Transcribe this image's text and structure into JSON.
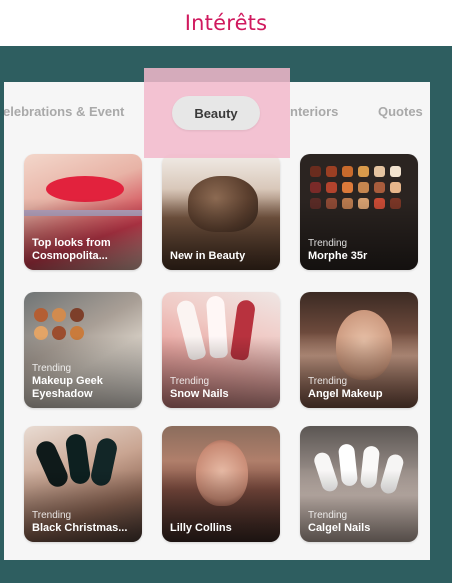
{
  "header": {
    "title": "Intérêts"
  },
  "tabs": [
    {
      "label": "elebrations & Event"
    },
    {
      "label": "Beauty"
    },
    {
      "label": "nteriors"
    },
    {
      "label": "Quotes"
    }
  ],
  "cards": [
    {
      "subtitle": "",
      "title": "Top looks from Cosmopolita..."
    },
    {
      "subtitle": "",
      "title": "New in Beauty"
    },
    {
      "subtitle": "Trending",
      "title": "Morphe 35r"
    },
    {
      "subtitle": "Trending",
      "title": "Makeup Geek Eyeshadow"
    },
    {
      "subtitle": "Trending",
      "title": "Snow Nails"
    },
    {
      "subtitle": "Trending",
      "title": "Angel Makeup"
    },
    {
      "subtitle": "Trending",
      "title": "Black Christmas..."
    },
    {
      "subtitle": "",
      "title": "Lilly Collins"
    },
    {
      "subtitle": "Trending",
      "title": "Calgel Nails"
    }
  ],
  "colors": {
    "title_accent": "#d0195e",
    "frame": "#2e5e60",
    "highlight": "#f2b8cb"
  }
}
